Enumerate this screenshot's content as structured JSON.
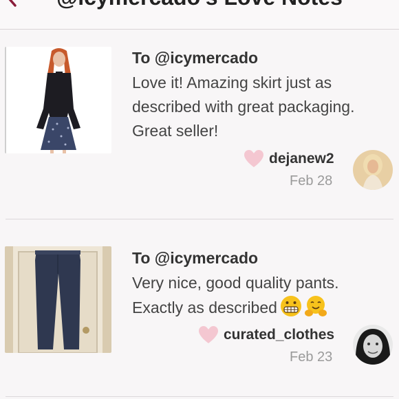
{
  "header": {
    "title": "@icymercado's Love Notes",
    "back_icon": "chevron-left-icon",
    "accent": "#8a1c3a"
  },
  "notes": [
    {
      "to": "To @icymercado",
      "message": "Love it! Amazing skirt just as described with great packaging. Great seller!",
      "username": "dejanew2",
      "date": "Feb 28",
      "heart_color": "#f4c7d1",
      "thumbnail": "product-skirt-image"
    },
    {
      "to": "To @icymercado",
      "message": "Very nice, good quality pants. Exactly as described",
      "emojis": [
        "grimacing-face-emoji",
        "hugging-face-emoji"
      ],
      "username": "curated_clothes",
      "date": "Feb 23",
      "heart_color": "#f4c7d1",
      "thumbnail": "product-pants-image"
    }
  ]
}
